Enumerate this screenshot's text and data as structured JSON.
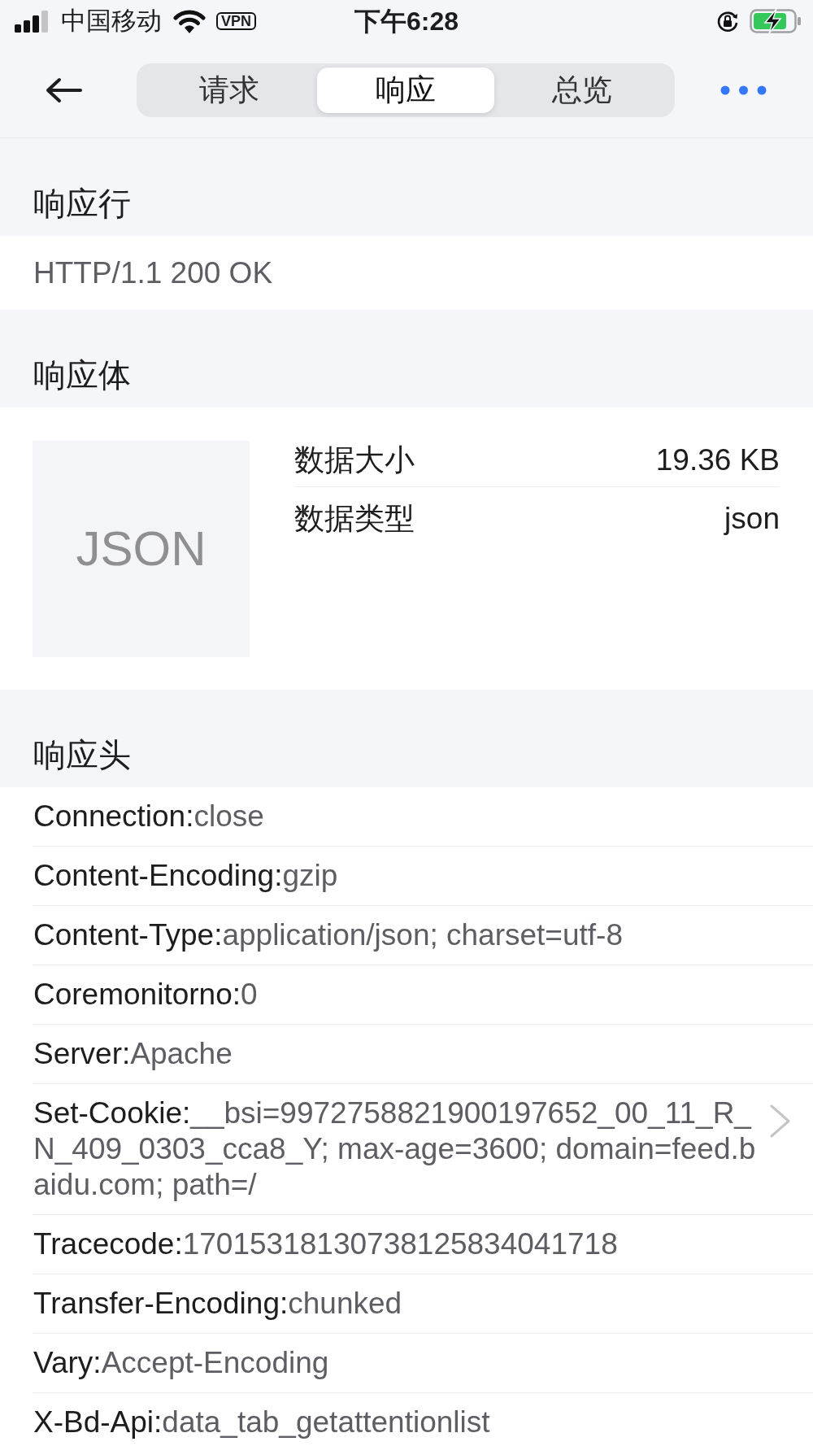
{
  "status_bar": {
    "carrier": "中国移动",
    "vpn": "VPN",
    "time": "下午6:28"
  },
  "nav": {
    "tabs": [
      {
        "label": "请求",
        "selected": false
      },
      {
        "label": "响应",
        "selected": true
      },
      {
        "label": "总览",
        "selected": false
      }
    ]
  },
  "response_line": {
    "title": "响应行",
    "value": "HTTP/1.1 200 OK"
  },
  "response_body": {
    "title": "响应体",
    "preview": "JSON",
    "info": [
      {
        "label": "数据大小",
        "value": "19.36 KB"
      },
      {
        "label": "数据类型",
        "value": "json"
      }
    ]
  },
  "response_headers": {
    "title": "响应头",
    "items": [
      {
        "name": "Connection:",
        "value": "close",
        "has_detail": false
      },
      {
        "name": "Content-Encoding:",
        "value": "gzip",
        "has_detail": false
      },
      {
        "name": "Content-Type:",
        "value": "application/json; charset=utf-8",
        "has_detail": false
      },
      {
        "name": "Coremonitorno:",
        "value": "0",
        "has_detail": false
      },
      {
        "name": "Server:",
        "value": "Apache",
        "has_detail": false
      },
      {
        "name": "Set-Cookie:",
        "value": "__bsi=9972758821900197652_00_11_R_N_409_0303_cca8_Y; max-age=3600; domain=feed.baidu.com; path=/",
        "has_detail": true
      },
      {
        "name": "Tracecode:",
        "value": "17015318130738125834041718",
        "has_detail": false
      },
      {
        "name": "Transfer-Encoding:",
        "value": "chunked",
        "has_detail": false
      },
      {
        "name": "Vary:",
        "value": "Accept-Encoding",
        "has_detail": false
      },
      {
        "name": "X-Bd-Api:",
        "value": "data_tab_getattentionlist",
        "has_detail": false
      }
    ]
  }
}
